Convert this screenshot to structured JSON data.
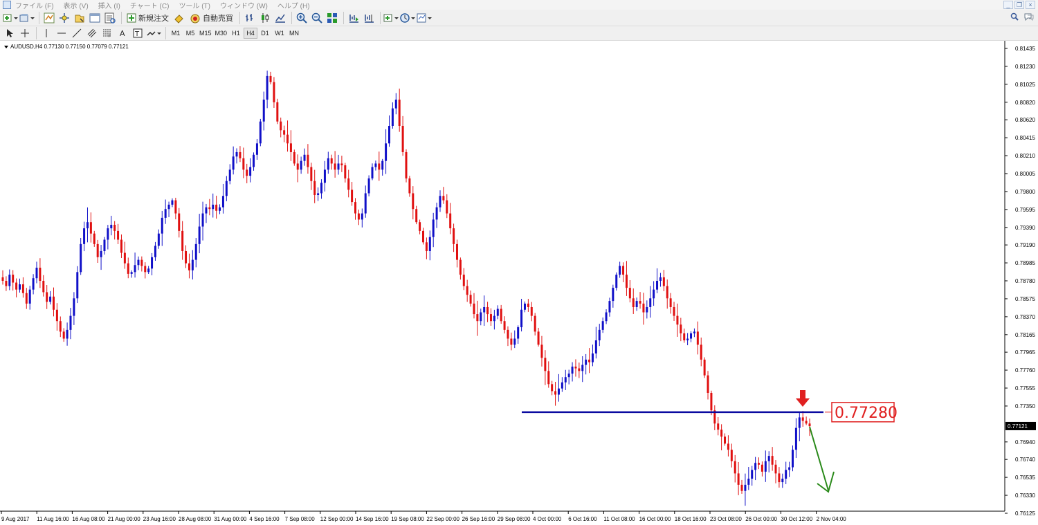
{
  "menu": [
    "ファイル (F)",
    "表示 (V)",
    "挿入 (I)",
    "チャート (C)",
    "ツール (T)",
    "ウィンドウ (W)",
    "ヘルプ (H)"
  ],
  "toolbar": {
    "new_order_label": "新規注文",
    "auto_trading_label": "自動売買",
    "timeframes": [
      "M1",
      "M5",
      "M15",
      "M30",
      "H1",
      "H4",
      "D1",
      "W1",
      "MN"
    ],
    "active_timeframe": "H4"
  },
  "chart_header": {
    "symbol": "AUDUSD,H4",
    "ohlc": "0.77130 0.77150 0.77079 0.77121"
  },
  "current_price_label": "0.77121",
  "annotation_price": "0.77280",
  "colors": {
    "bull": "#1010c8",
    "bear": "#e01010",
    "level_line": "#0a0aa0",
    "annotation": "#e02020",
    "arrow_green": "#2a8a1a"
  },
  "chart_data": {
    "type": "candlestick",
    "symbol": "AUDUSD",
    "timeframe": "H4",
    "y_ticks": [
      0.81435,
      0.8123,
      0.81025,
      0.8082,
      0.8062,
      0.80415,
      0.8021,
      0.80005,
      0.798,
      0.79595,
      0.7939,
      0.7919,
      0.78985,
      0.7878,
      0.78575,
      0.7837,
      0.78165,
      0.77965,
      0.7776,
      0.77555,
      0.7735,
      0.7694,
      0.7674,
      0.76535,
      0.7633,
      0.76125
    ],
    "y_tick_labels": [
      "0.81435",
      "0.81230",
      "0.81025",
      "0.80820",
      "0.80620",
      "0.80415",
      "0.80210",
      "0.80005",
      "0.79800",
      "0.79595",
      "0.79390",
      "0.79190",
      "0.78985",
      "0.78780",
      "0.78575",
      "0.78370",
      "0.78165",
      "0.77965",
      "0.77760",
      "0.77555",
      "0.77350",
      "0.76940",
      "0.76740",
      "0.76535",
      "0.76330",
      "0.76125"
    ],
    "x_labels": [
      "9 Aug 2017",
      "11 Aug 16:00",
      "16 Aug 08:00",
      "21 Aug 00:00",
      "23 Aug 16:00",
      "28 Aug 08:00",
      "31 Aug 00:00",
      "4 Sep 16:00",
      "7 Sep 08:00",
      "12 Sep 00:00",
      "14 Sep 16:00",
      "19 Sep 08:00",
      "22 Sep 00:00",
      "26 Sep 16:00",
      "29 Sep 08:00",
      "4 Oct 00:00",
      "6 Oct 16:00",
      "11 Oct 08:00",
      "16 Oct 00:00",
      "18 Oct 16:00",
      "23 Oct 08:00",
      "26 Oct 00:00",
      "30 Oct 12:00",
      "2 Nov 04:00"
    ],
    "close_path": [
      0.7878,
      0.7872,
      0.7885,
      0.7876,
      0.7868,
      0.7874,
      0.7864,
      0.7852,
      0.7868,
      0.7881,
      0.7893,
      0.7878,
      0.7865,
      0.7854,
      0.786,
      0.7845,
      0.7832,
      0.782,
      0.7812,
      0.7822,
      0.7838,
      0.7858,
      0.7888,
      0.792,
      0.7938,
      0.7945,
      0.7932,
      0.792,
      0.7905,
      0.7912,
      0.7925,
      0.7938,
      0.7942,
      0.7935,
      0.7925,
      0.791,
      0.7898,
      0.7886,
      0.7888,
      0.7896,
      0.7902,
      0.7895,
      0.7888,
      0.7892,
      0.7905,
      0.7918,
      0.7932,
      0.795,
      0.796,
      0.7965,
      0.797,
      0.7955,
      0.7935,
      0.7912,
      0.7898,
      0.789,
      0.7902,
      0.792,
      0.794,
      0.7955,
      0.7962,
      0.796,
      0.7965,
      0.7958,
      0.7962,
      0.7975,
      0.7992,
      0.8005,
      0.802,
      0.8025,
      0.8018,
      0.8005,
      0.7998,
      0.8008,
      0.8022,
      0.8035,
      0.806,
      0.8085,
      0.8112,
      0.8105,
      0.8082,
      0.806,
      0.805,
      0.8045,
      0.8035,
      0.8025,
      0.8012,
      0.8005,
      0.8015,
      0.8022,
      0.8008,
      0.7992,
      0.7976,
      0.7978,
      0.799,
      0.8005,
      0.8018,
      0.8012,
      0.8005,
      0.8012,
      0.801,
      0.7995,
      0.7982,
      0.7968,
      0.7955,
      0.7948,
      0.7955,
      0.7978,
      0.7995,
      0.8008,
      0.8012,
      0.8005,
      0.8015,
      0.8035,
      0.8055,
      0.8075,
      0.8085,
      0.8055,
      0.8025,
      0.7995,
      0.7978,
      0.796,
      0.7945,
      0.7935,
      0.7922,
      0.7912,
      0.7928,
      0.7948,
      0.7962,
      0.7975,
      0.797,
      0.7955,
      0.7938,
      0.792,
      0.7902,
      0.7885,
      0.7872,
      0.7862,
      0.7852,
      0.784,
      0.7832,
      0.7842,
      0.7848,
      0.784,
      0.7832,
      0.7838,
      0.7846,
      0.7832,
      0.7822,
      0.7812,
      0.7805,
      0.7812,
      0.7825,
      0.7845,
      0.7852,
      0.7848,
      0.7838,
      0.782,
      0.7805,
      0.779,
      0.7775,
      0.776,
      0.7752,
      0.7748,
      0.7755,
      0.7762,
      0.7768,
      0.7772,
      0.778,
      0.7778,
      0.7775,
      0.7782,
      0.7788,
      0.7785,
      0.7795,
      0.781,
      0.7822,
      0.7832,
      0.7842,
      0.7855,
      0.787,
      0.7885,
      0.7895,
      0.7885,
      0.787,
      0.7858,
      0.7848,
      0.7855,
      0.7852,
      0.7842,
      0.7848,
      0.7858,
      0.7868,
      0.7878,
      0.7882,
      0.7872,
      0.7858,
      0.7848,
      0.7838,
      0.7828,
      0.7818,
      0.781,
      0.7812,
      0.7818,
      0.782,
      0.7805,
      0.7788,
      0.777,
      0.775,
      0.773,
      0.7715,
      0.7708,
      0.77,
      0.7692,
      0.7685,
      0.7672,
      0.7658,
      0.7645,
      0.7638,
      0.7645,
      0.7652,
      0.7662,
      0.767,
      0.7668,
      0.766,
      0.7672,
      0.7678,
      0.7668,
      0.7658,
      0.7648,
      0.7652,
      0.7662,
      0.7665,
      0.7685,
      0.771,
      0.7722,
      0.7718,
      0.7715,
      0.7712
    ],
    "horizontal_line": 0.7728,
    "current_price": 0.77121
  }
}
